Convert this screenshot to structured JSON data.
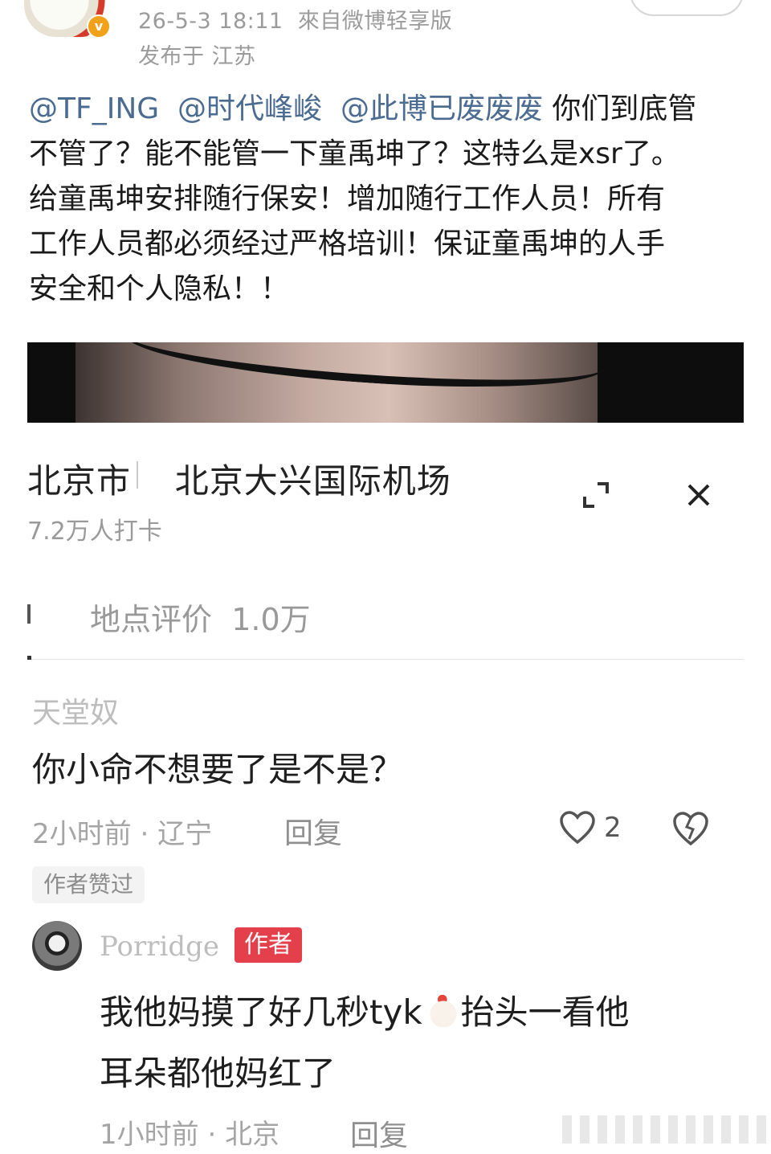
{
  "header": {
    "timestamp": "26-5-3 18:11",
    "source": "來自微博轻享版",
    "location": "发布于 江苏"
  },
  "post": {
    "mentions": [
      "@TF_ING",
      "@时代峰峻",
      "@此博已废废废"
    ],
    "line1_tail": "你们到底管",
    "line2": "不管了？能不能管一下童禹坤了？这特么是xsr了。",
    "line3": "给童禹坤安排随行保安！增加随行工作人员！所有",
    "line4": "工作人员都必须经过严格培训！保证童禹坤的人手",
    "line5": "安全和个人隐私！！"
  },
  "location_card": {
    "city": "北京市",
    "place": "北京大兴国际机场",
    "checkins": "7.2万人打卡",
    "review_label": "地点评价",
    "review_count": "1.0万",
    "expand_icon": "expand-icon",
    "close_icon": "close-icon"
  },
  "comments": [
    {
      "user": "天堂奴",
      "text": "你小命不想要了是不是？",
      "time": "2小时前",
      "region": "辽宁",
      "reply_label": "回复",
      "likes": "2",
      "badge": "作者赞过"
    },
    {
      "user": "Porridge",
      "author_tag": "作者",
      "text_line1_a": "我他妈摸了好几秒tyk",
      "text_line1_b": "抬头一看他",
      "text_line2": "耳朵都他妈红了",
      "time": "1小时前",
      "region": "北京",
      "reply_label": "回复"
    }
  ],
  "colors": {
    "mention": "#4b6b91",
    "author_tag": "#e4404c",
    "meta_gray": "#9b9b9b"
  }
}
